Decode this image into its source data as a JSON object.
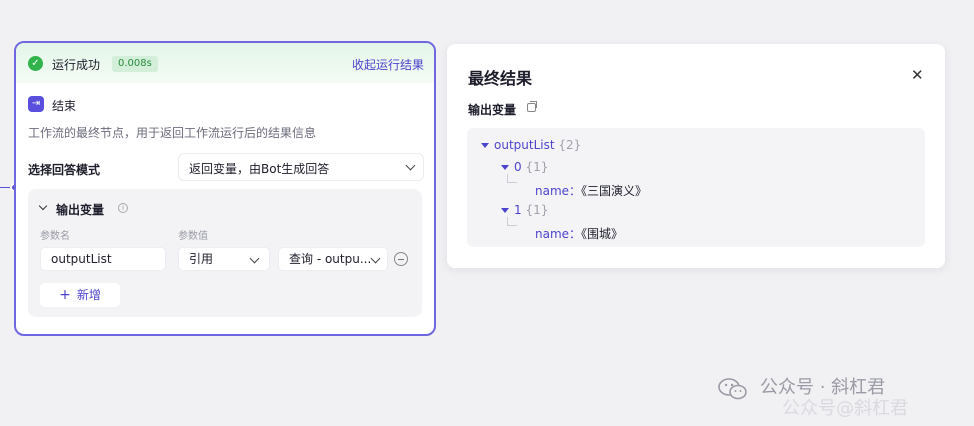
{
  "node": {
    "status_text": "运行成功",
    "duration": "0.008s",
    "collapse_label": "收起运行结果",
    "title": "结束",
    "description": "工作流的最终节点，用于返回工作流运行后的结果信息",
    "mode_label": "选择回答模式",
    "mode_value": "返回变量，由Bot生成回答",
    "output": {
      "title": "输出变量",
      "col_name": "参数名",
      "col_value": "参数值",
      "var_name": "outputList",
      "ref_type": "引用",
      "ref_value": "查询 - outpu...",
      "add_label": "新增"
    }
  },
  "result": {
    "title": "最终结果",
    "output_label": "输出变量",
    "tree": {
      "root_key": "outputList",
      "root_count": "{2}",
      "items": [
        {
          "index": "0",
          "count": "{1}",
          "key": "name",
          "sep": "：",
          "value": "《三国演义》"
        },
        {
          "index": "1",
          "count": "{1}",
          "key": "name",
          "sep": "：",
          "value": "《围城》"
        }
      ]
    }
  },
  "watermark": {
    "text": "公众号 · 斜杠君",
    "text2": "公众号@斜杠君"
  },
  "colors": {
    "accent": "#4d44cc",
    "border": "#6e67e0",
    "success": "#2fb34a"
  }
}
